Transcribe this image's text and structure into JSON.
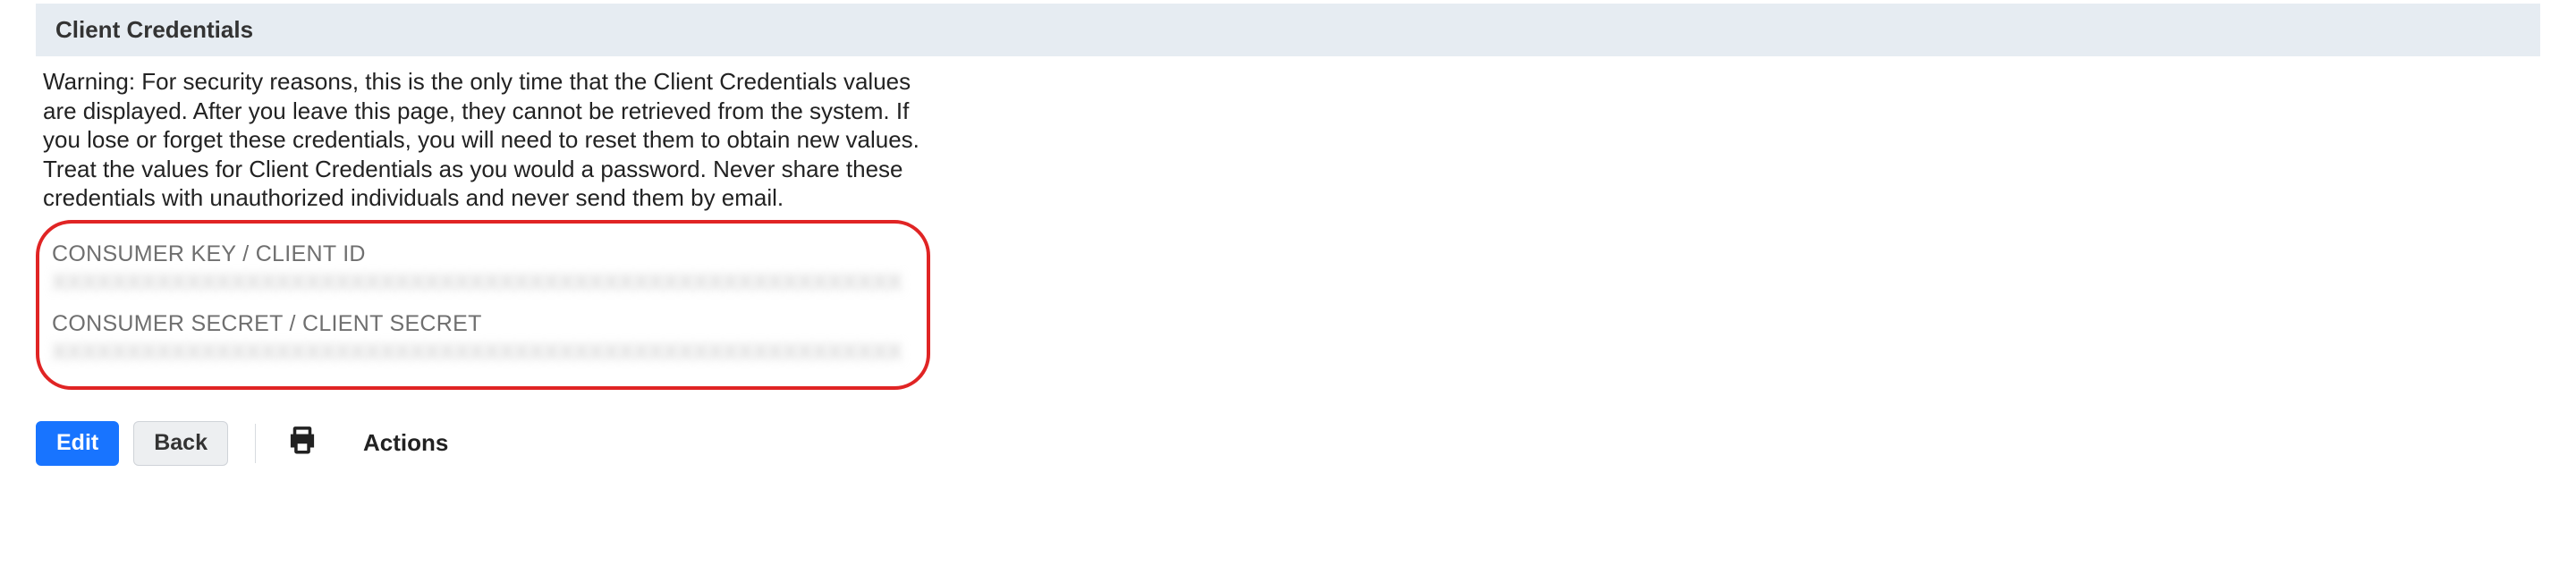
{
  "section": {
    "title": "Client Credentials",
    "warning_p1": "Warning: For security reasons, this is the only time that the Client Credentials values are displayed. After you leave this page, they cannot be retrieved from the system. If you lose or forget these credentials, you will need to reset them to obtain new values.",
    "warning_p2": "Treat the values for Client Credentials as you would a password. Never share these credentials with unauthorized individuals and never send them by email."
  },
  "credentials": {
    "consumer_key_label": "CONSUMER KEY / CLIENT ID",
    "consumer_key_value": "XXXXXXXXXXXXXXXXXXXXXXXXXXXXXXXXXXXXXXXXXXXXXXXXXXXXXXXXXXXXXXXX",
    "consumer_secret_label": "CONSUMER SECRET / CLIENT SECRET",
    "consumer_secret_value": "XXXXXXXXXXXXXXXXXXXXXXXXXXXXXXXXXXXXXXXXXXXXXXXXXXXXXXXXXXXXXXXX"
  },
  "buttons": {
    "edit": "Edit",
    "back": "Back",
    "actions": "Actions"
  }
}
